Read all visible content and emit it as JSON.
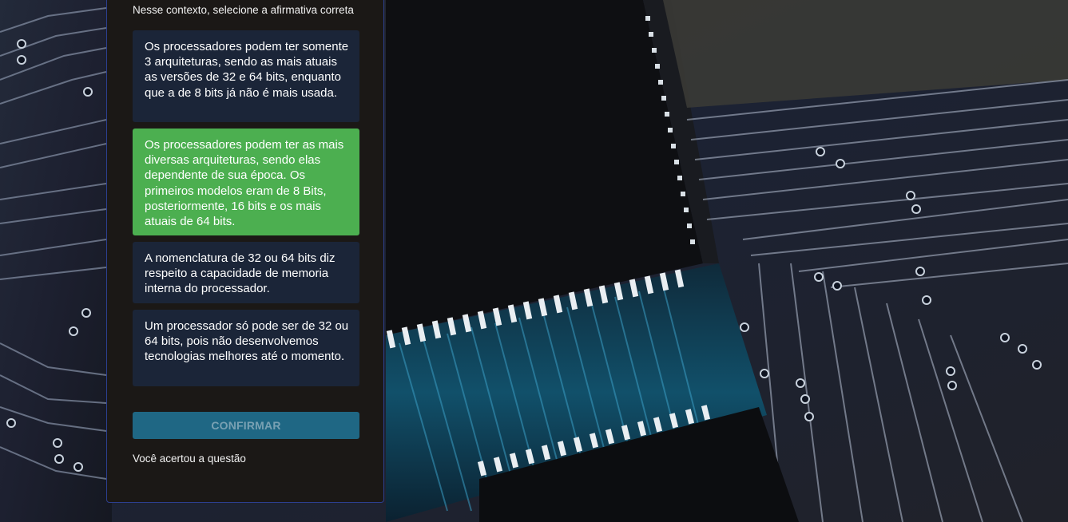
{
  "question": {
    "prompt": "Nesse contexto, selecione a afirmativa correta",
    "options": [
      {
        "text": "Os processadores podem ter somente 3 arquiteturas, sendo as mais atuais as versões de 32 e 64 bits, enquanto que a de 8 bits já não é mais usada.",
        "selected": false
      },
      {
        "text": "Os processadores podem ter as mais diversas arquiteturas, sendo elas dependente de sua época. Os primeiros modelos eram de 8 Bits, posteriormente, 16 bits e os mais atuais de 64 bits.",
        "selected": true
      },
      {
        "text": "A nomenclatura de 32 ou 64 bits diz respeito a capacidade de memoria interna do processador.",
        "selected": false
      },
      {
        "text": "Um processador só pode ser de 32 ou 64 bits, pois não desenvolvemos tecnologias melhores até o momento.",
        "selected": false
      }
    ],
    "confirm_label": "CONFIRMAR",
    "result_message": "Você acertou a questão"
  },
  "colors": {
    "panel_bg": "#1b1816",
    "option_bg": "#1b2538",
    "selected_bg": "#4caf50",
    "confirm_bg": "#1f6784",
    "panel_border": "#2c3f8f"
  },
  "background": {
    "icon": "circuit-board-image"
  }
}
